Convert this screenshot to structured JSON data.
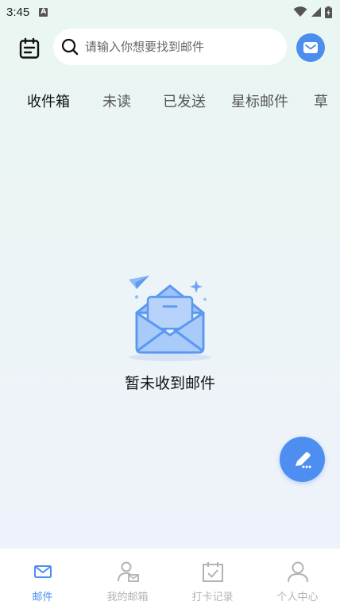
{
  "status_bar": {
    "time": "3:45",
    "notification_badge": "A"
  },
  "header": {
    "search_placeholder": "请输入你想要找到邮件"
  },
  "tabs": [
    {
      "label": "收件箱",
      "active": true
    },
    {
      "label": "未读",
      "active": false
    },
    {
      "label": "已发送",
      "active": false
    },
    {
      "label": "星标邮件",
      "active": false
    },
    {
      "label": "草",
      "active": false
    }
  ],
  "empty_state": {
    "message": "暂未收到邮件",
    "icon": "open-envelope-icon"
  },
  "fab": {
    "icon": "edit-pencil-icon"
  },
  "bottom_nav": [
    {
      "label": "邮件",
      "icon": "mail-icon",
      "active": true
    },
    {
      "label": "我的邮箱",
      "icon": "user-mail-icon",
      "active": false
    },
    {
      "label": "打卡记录",
      "icon": "calendar-check-icon",
      "active": false
    },
    {
      "label": "个人中心",
      "icon": "person-icon",
      "active": false
    }
  ],
  "colors": {
    "accent": "#4c8df0",
    "inactive": "#b3b3b3"
  }
}
